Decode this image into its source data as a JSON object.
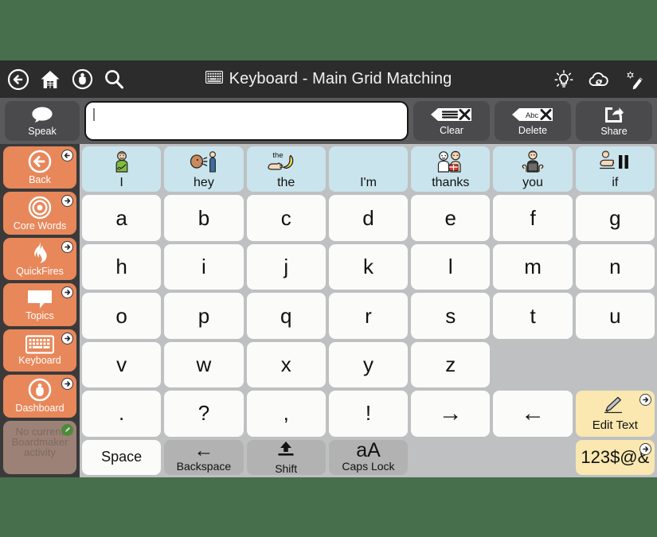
{
  "window": {
    "background_color": "#476F4C"
  },
  "header": {
    "title": "Keyboard - Main Grid Matching",
    "title_icon": "keyboard-icon",
    "left_icons": [
      {
        "name": "back-icon",
        "label": "Back"
      },
      {
        "name": "home-icon",
        "label": "Home"
      },
      {
        "name": "dashboard-gauge-icon",
        "label": "Dashboard"
      },
      {
        "name": "search-icon",
        "label": "Search"
      }
    ],
    "right_icons": [
      {
        "name": "lightbulb-icon",
        "label": "Hints"
      },
      {
        "name": "cloud-sync-icon",
        "label": "Sync"
      },
      {
        "name": "magic-wand-icon",
        "label": "Edit Mode"
      }
    ]
  },
  "toolbar": {
    "speak_label": "Speak",
    "speak_icon": "speech-bubble-icon",
    "clear_label": "Clear",
    "clear_icon": "clear-tag-icon",
    "delete_label": "Delete",
    "delete_icon": "delete-abc-icon",
    "share_label": "Share",
    "share_icon": "share-box-arrow-icon",
    "message_value": "",
    "message_placeholder": ""
  },
  "sidebar": {
    "items": [
      {
        "label": "Back",
        "icon": "back-circle-icon",
        "badge": "arrow-left-badge",
        "muted": false
      },
      {
        "label": "Core Words",
        "icon": "target-icon",
        "badge": "arrow-right-badge",
        "muted": false
      },
      {
        "label": "QuickFires",
        "icon": "flame-icon",
        "badge": "arrow-right-badge",
        "muted": false
      },
      {
        "label": "Topics",
        "icon": "speech-bubble-icon",
        "badge": "arrow-right-badge",
        "muted": false
      },
      {
        "label": "Keyboard",
        "icon": "keyboard-icon",
        "badge": "arrow-right-badge",
        "muted": false
      },
      {
        "label": "Dashboard",
        "icon": "gauge-icon",
        "badge": "arrow-right-badge",
        "muted": false
      },
      {
        "label": "No current Boardmaker activity",
        "icon": "",
        "badge": "pencil-badge",
        "muted": true
      }
    ]
  },
  "grid": {
    "predictions": [
      {
        "word": "I",
        "symbol": "person-pointing-self-symbol"
      },
      {
        "word": "hey",
        "symbol": "person-calling-symbol"
      },
      {
        "word": "the",
        "symbol": "hand-pointing-banana-symbol"
      },
      {
        "word": "I'm",
        "symbol": ""
      },
      {
        "word": "thanks",
        "symbol": "two-people-gift-symbol"
      },
      {
        "word": "you",
        "symbol": "hands-pointing-person-symbol"
      },
      {
        "word": "if",
        "symbol": "hand-two-bars-symbol"
      }
    ],
    "rows": [
      [
        "a",
        "b",
        "c",
        "d",
        "e",
        "f",
        "g"
      ],
      [
        "h",
        "i",
        "j",
        "k",
        "l",
        "m",
        "n"
      ],
      [
        "o",
        "p",
        "q",
        "r",
        "s",
        "t",
        "u"
      ],
      [
        "v",
        "w",
        "x",
        "y",
        "z"
      ]
    ],
    "punctuation_row": [
      {
        "type": "key",
        "label": "."
      },
      {
        "type": "key",
        "label": "?"
      },
      {
        "type": "key",
        "label": ","
      },
      {
        "type": "key",
        "label": "!"
      },
      {
        "type": "key",
        "label": "→",
        "name": "cursor-right-key"
      },
      {
        "type": "key",
        "label": "←",
        "name": "cursor-left-key"
      }
    ],
    "bottom_row": [
      {
        "type": "word",
        "label": "Space",
        "name": "space-key"
      },
      {
        "type": "mod",
        "label": "Backspace",
        "glyph": "←",
        "name": "backspace-key"
      },
      {
        "type": "mod",
        "label": "Shift",
        "glyph": "shift-arrow",
        "name": "shift-key"
      },
      {
        "type": "mod",
        "label": "Caps Lock",
        "glyph": "aA",
        "name": "caps-lock-key"
      }
    ],
    "edit_text": {
      "label": "Edit Text",
      "icon": "pencil-icon",
      "badge": "arrow-right-badge"
    },
    "symbols_key": {
      "label": "123$@&",
      "badge": "arrow-right-badge"
    }
  }
}
